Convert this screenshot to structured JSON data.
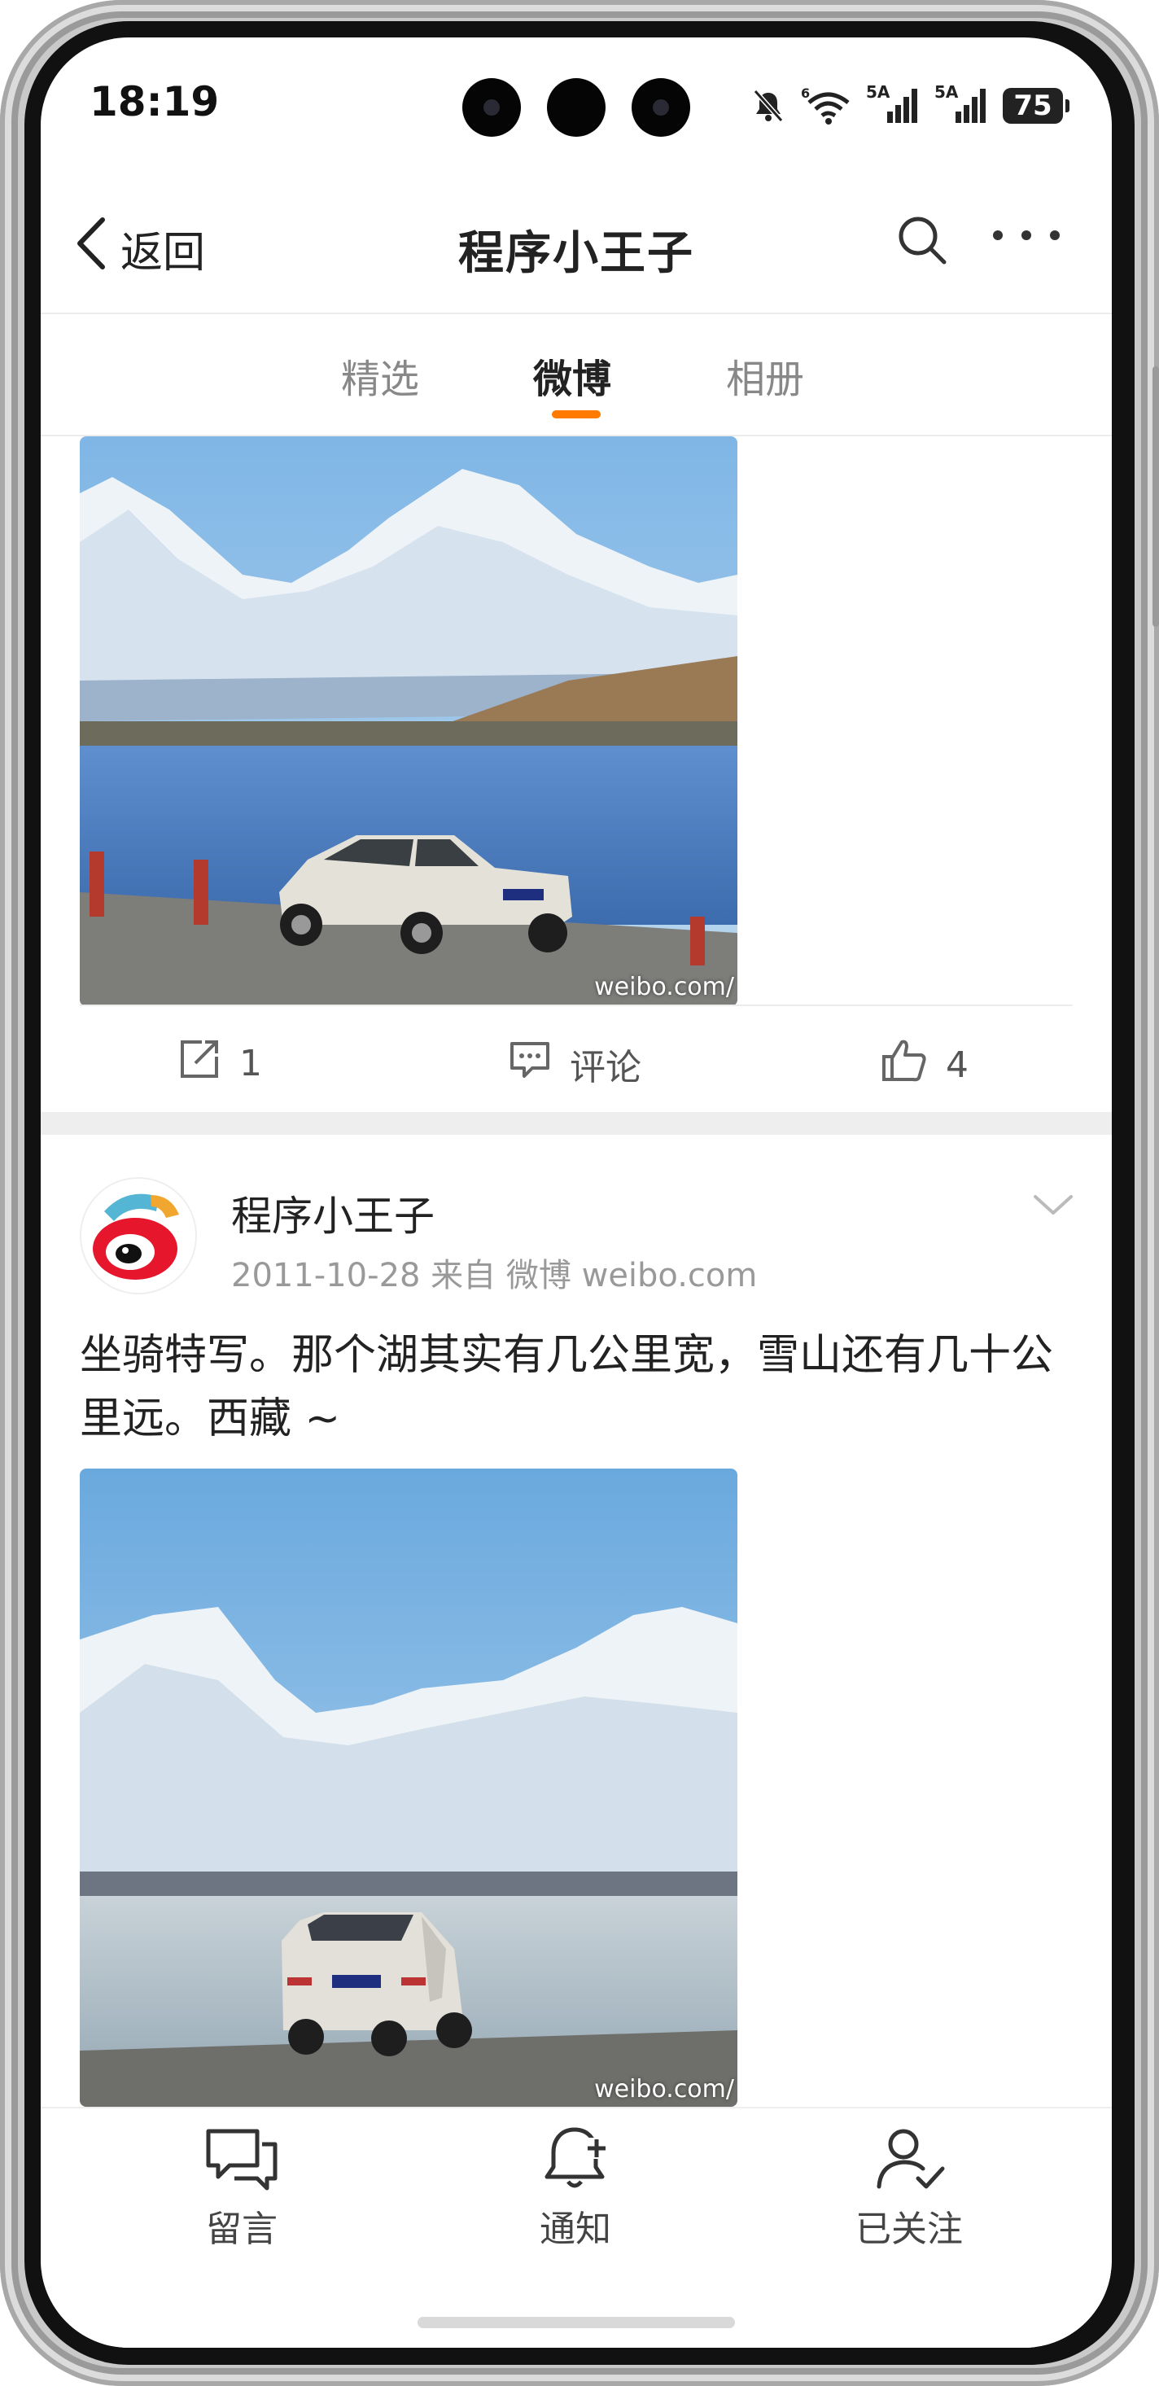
{
  "status_bar": {
    "time": "18:19",
    "network_1": "5A",
    "network_2": "5A",
    "battery": "75",
    "icons": [
      "mute-bell-icon",
      "wifi-icon",
      "signal-icon",
      "signal-icon",
      "battery-icon"
    ]
  },
  "header": {
    "back_label": "返回",
    "title": "程序小王子",
    "icons": [
      "chevron-left-icon",
      "search-icon",
      "more-icon"
    ]
  },
  "tabs": [
    {
      "label": "精选",
      "active": false
    },
    {
      "label": "微博",
      "active": true
    },
    {
      "label": "相册",
      "active": false
    }
  ],
  "accent_color": "#ff7a00",
  "post_1": {
    "watermark": "weibo.com/",
    "actions": {
      "repost_count": "1",
      "comment_label": "评论",
      "like_count": "4"
    }
  },
  "post_2": {
    "user_name": "程序小王子",
    "meta": "2011-10-28  来自 微博 weibo.com",
    "text": "坐骑特写。那个湖其实有几公里宽，雪山还有几十公里远。西藏 ~",
    "watermark": "weibo.com/"
  },
  "bottom_nav": [
    {
      "label": "留言",
      "icon": "message-icon"
    },
    {
      "label": "通知",
      "icon": "bell-plus-icon"
    },
    {
      "label": "已关注",
      "icon": "user-check-icon"
    }
  ]
}
